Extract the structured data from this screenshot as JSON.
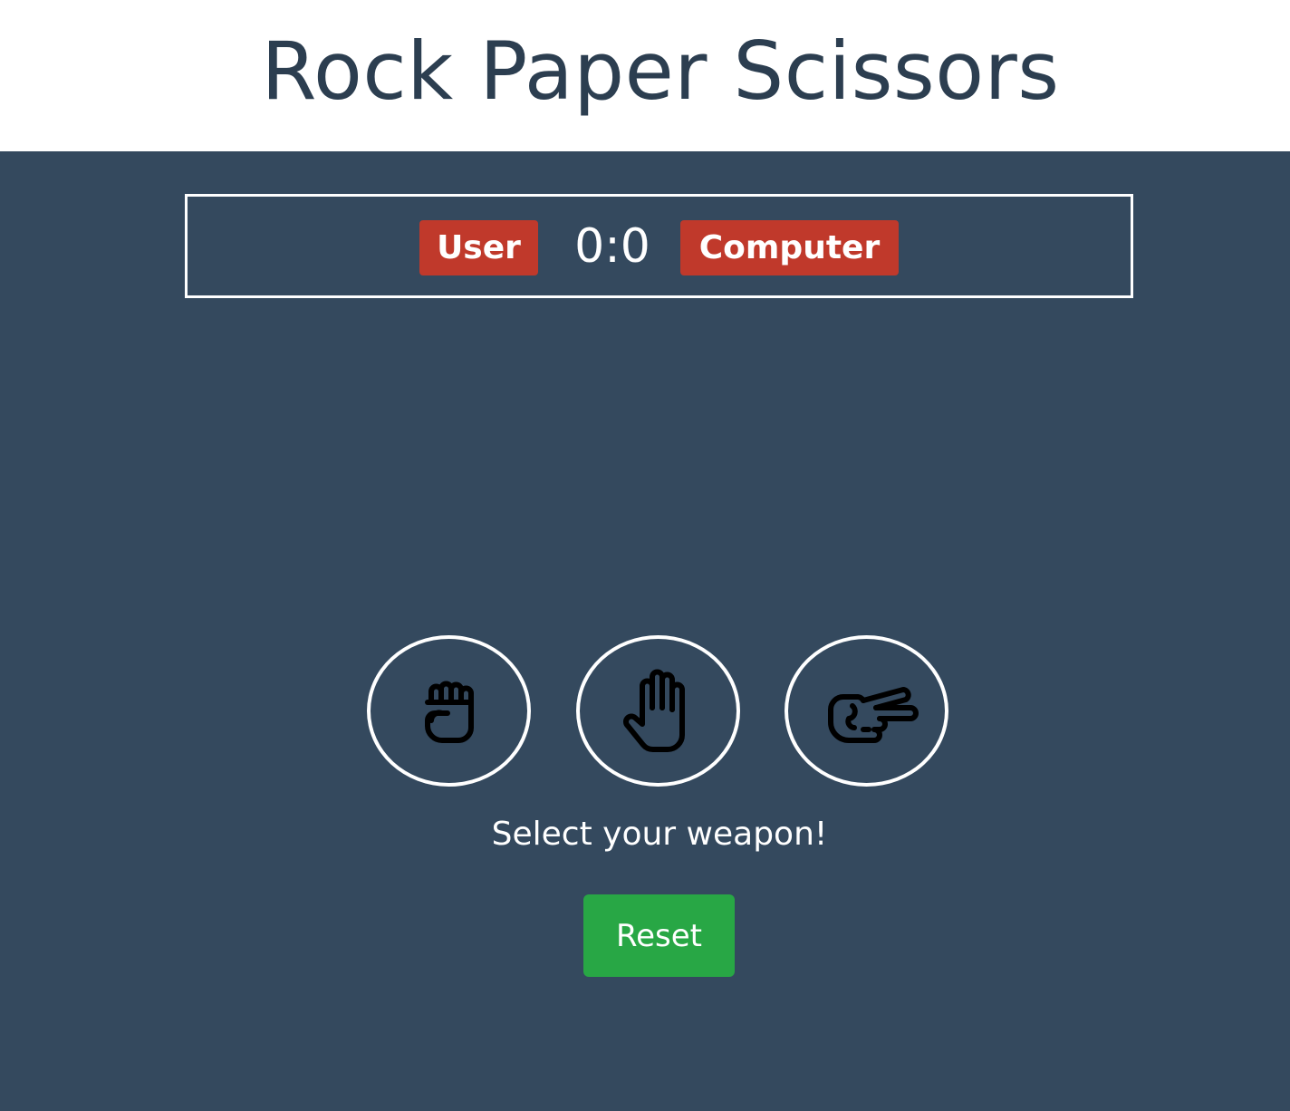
{
  "header": {
    "title": "Rock Paper Scissors"
  },
  "scoreboard": {
    "user_label": "User",
    "score": "0:0",
    "computer_label": "Computer"
  },
  "choices": [
    {
      "name": "rock",
      "icon": "hand-rock-icon"
    },
    {
      "name": "paper",
      "icon": "hand-paper-icon"
    },
    {
      "name": "scissors",
      "icon": "hand-scissors-icon"
    }
  ],
  "message": "Select your weapon!",
  "reset_label": "Reset",
  "colors": {
    "background": "#34495e",
    "header_bg": "#ffffff",
    "title_text": "#2c3e50",
    "badge": "#c0392b",
    "reset_button": "#28a745"
  }
}
